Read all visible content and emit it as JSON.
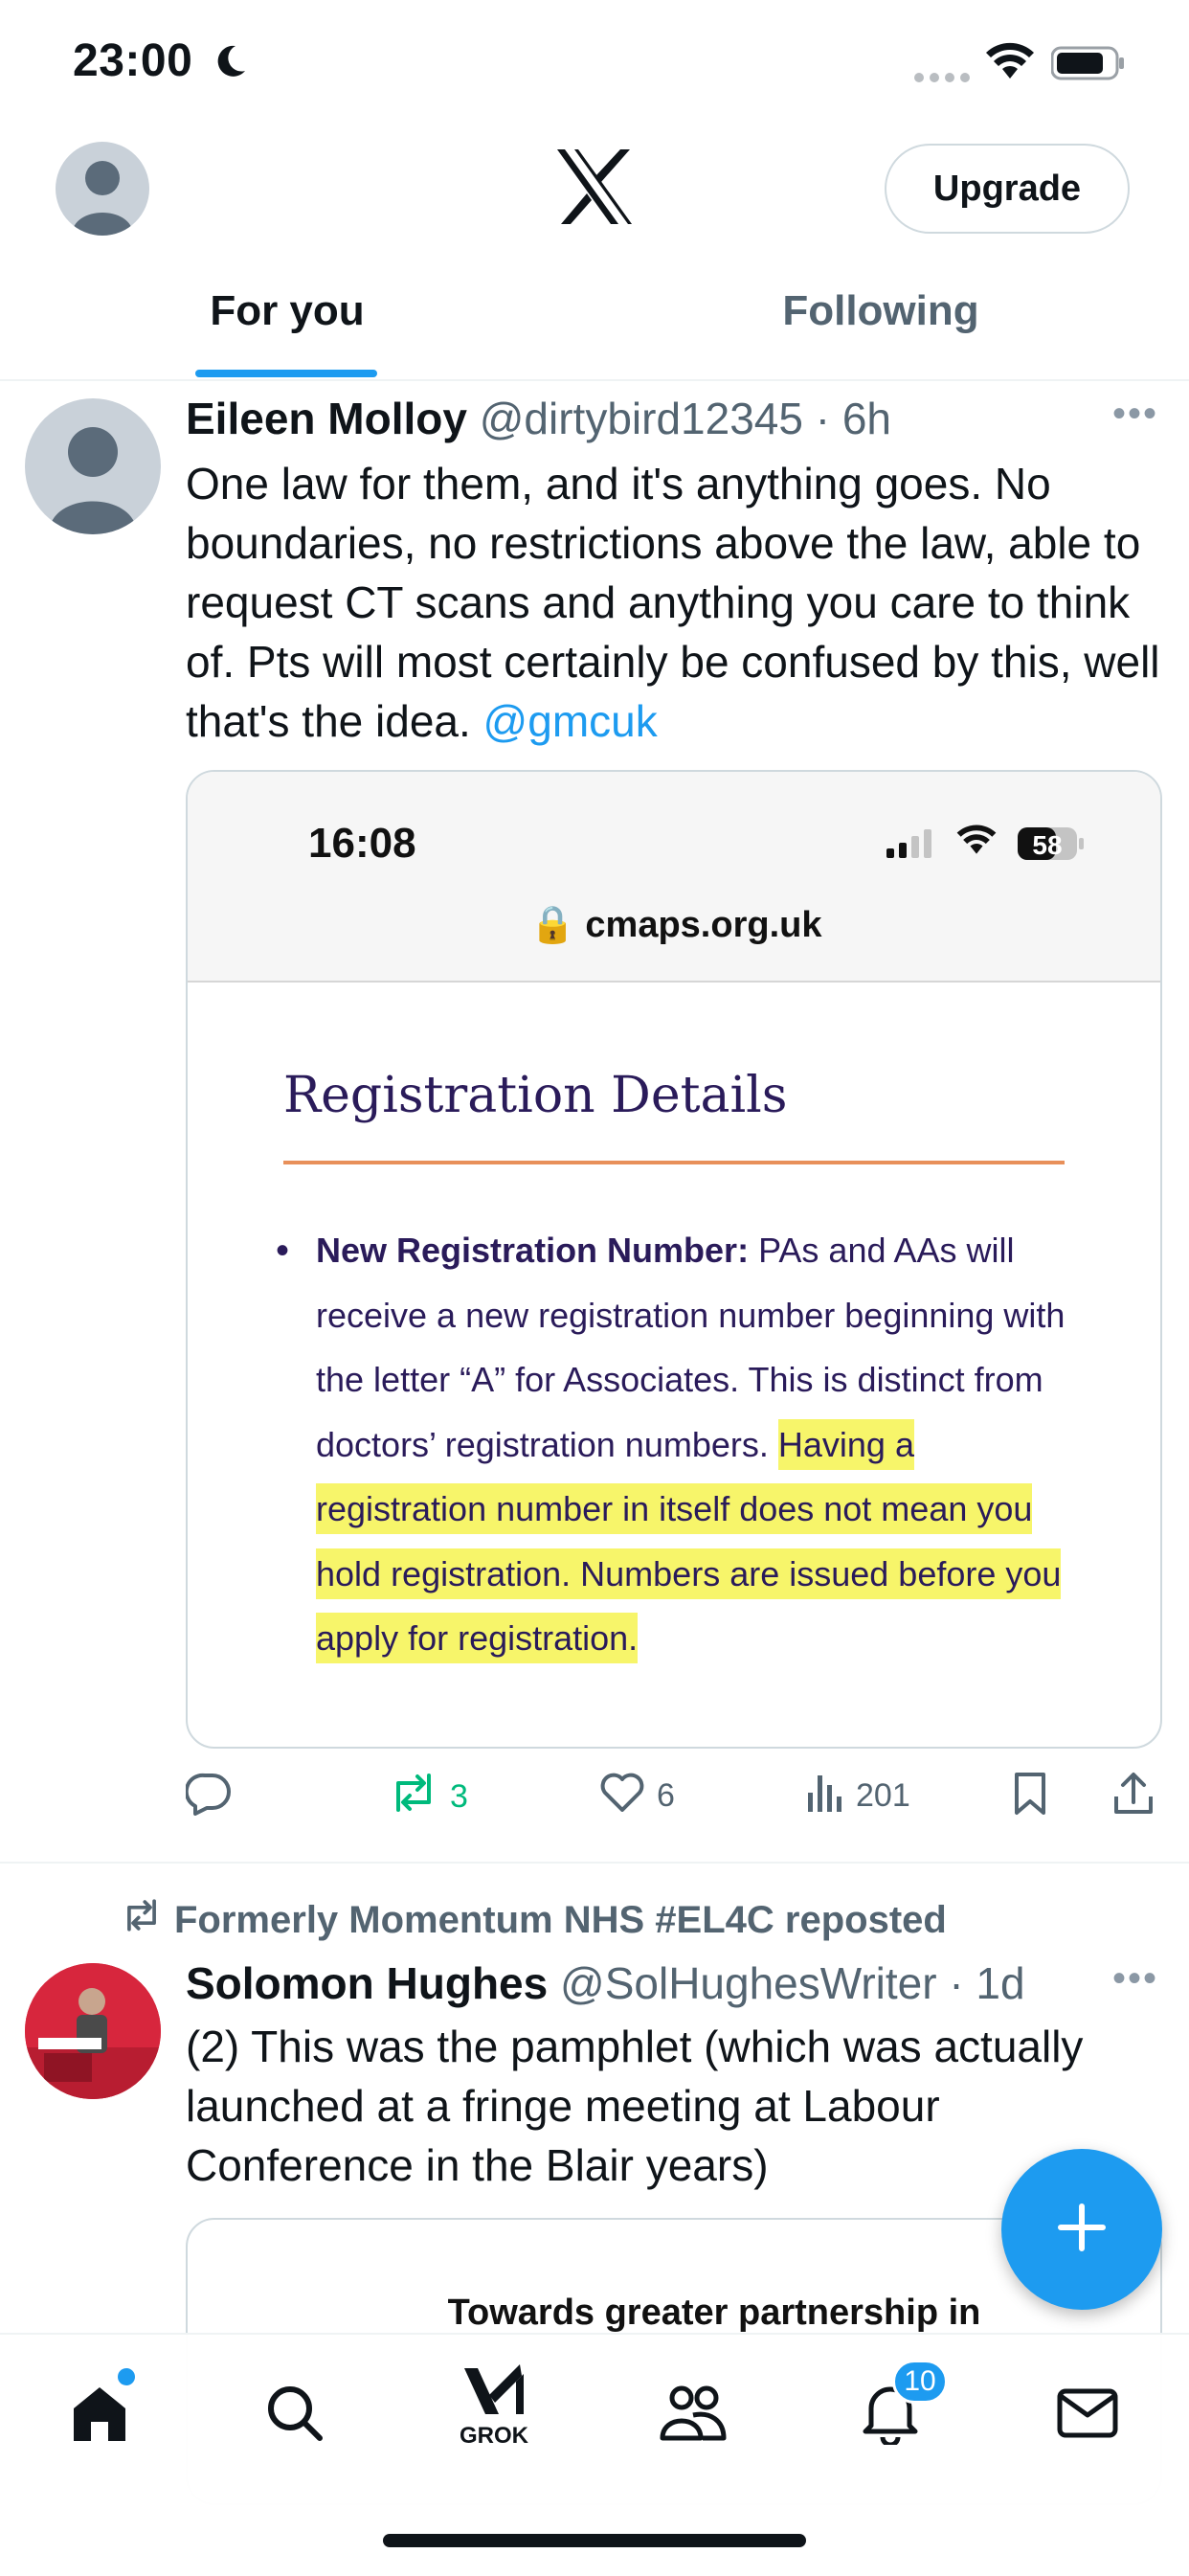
{
  "status_bar": {
    "time": "23:00",
    "icons": [
      "moon-icon",
      "signal-icon",
      "wifi-icon",
      "battery-icon"
    ]
  },
  "header": {
    "logo": "x-logo",
    "upgrade_label": "Upgrade"
  },
  "tabs": [
    {
      "label": "For you",
      "active": true
    },
    {
      "label": "Following",
      "active": false
    }
  ],
  "posts": [
    {
      "author_name": "Eileen Molloy",
      "author_meta": "@dirtybird12345 · 6h",
      "text": "One law for them, and it's anything goes. No boundaries, no restrictions above the law, able to request CT scans and anything you care to think of. Pts will most certainly be confused by this, well that's the idea. ",
      "mention": "@gmcuk",
      "media": {
        "time": "16:08",
        "battery": "58",
        "url": "cmaps.org.uk",
        "heading": "Registration Details",
        "bullet_label": "New Registration Number:",
        "body_plain": " PAs and AAs will receive a new registration number beginning with the letter “A” for Associates. This is distinct from doctors’ registration numbers. ",
        "body_highlighted": "Having a registration number in itself does not mean you hold registration. Numbers are issued before you apply for registration."
      },
      "actions": {
        "reply": "",
        "reposts": "3",
        "likes": "6",
        "views": "201"
      }
    },
    {
      "reposted_by": "Formerly Momentum NHS #EL4C reposted",
      "author_name": "Solomon Hughes",
      "author_meta": "@SolHughesWriter · 1d",
      "text": "(2) This was the pamphlet (which was actually launched at a fringe meeting at Labour Conference in the Blair years)",
      "media": {
        "text": "Towards greater partnership in"
      }
    }
  ],
  "bottom_nav": {
    "grok_label": "GROK",
    "notifications_badge": "10"
  },
  "colors": {
    "accent": "#1d9bf0",
    "repost_green": "#00ba7c",
    "text": "#0f1419",
    "muted": "#536471",
    "highlight": "#f7f56a"
  }
}
